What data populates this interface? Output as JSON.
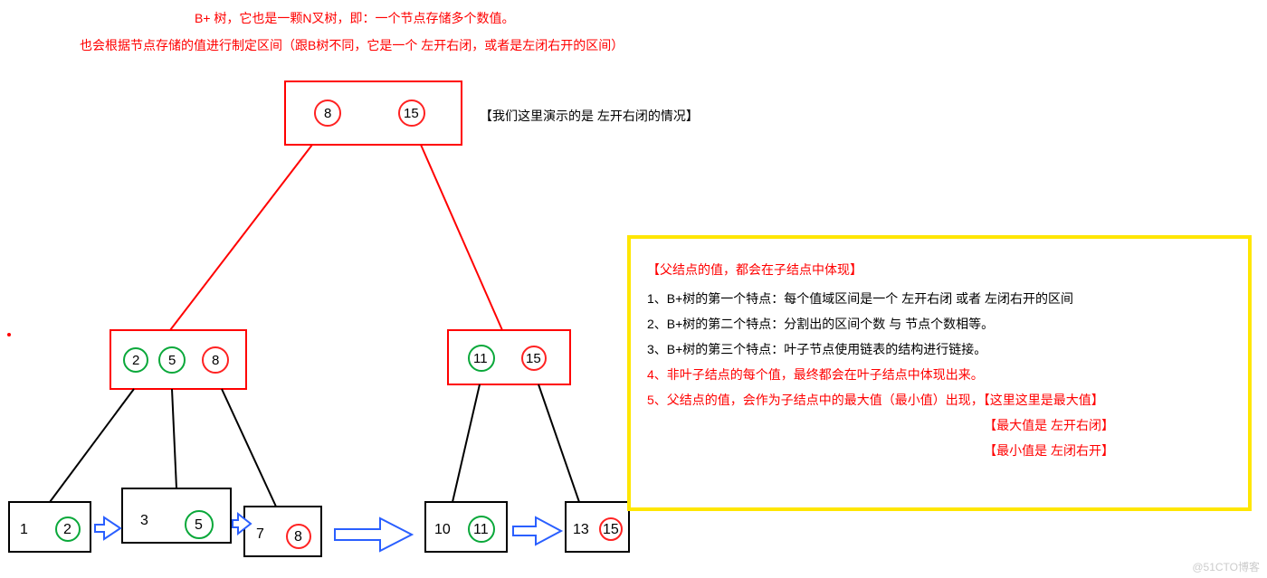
{
  "header": {
    "line1": "B+ 树，它也是一颗N叉树，即：一个节点存储多个数值。",
    "line2": "也会根据节点存储的值进行制定区间（跟B树不同，它是一个 左开右闭，或者是左闭右开的区间）"
  },
  "root": {
    "values": [
      "8",
      "15"
    ],
    "note": "【我们这里演示的是 左开右闭的情况】"
  },
  "mid_left": {
    "values": [
      "2",
      "5",
      "8"
    ]
  },
  "mid_right": {
    "values": [
      "11",
      "15"
    ]
  },
  "leaves": [
    {
      "values": [
        "1",
        "2"
      ]
    },
    {
      "values": [
        "3",
        "5"
      ]
    },
    {
      "values": [
        "7",
        "8"
      ]
    },
    {
      "values": [
        "10",
        "11"
      ]
    },
    {
      "values": [
        "13",
        "15"
      ]
    }
  ],
  "infobox": {
    "title": "【父结点的值，都会在子结点中体现】",
    "items": [
      "1、B+树的第一个特点：每个值域区间是一个 左开右闭 或者 左闭右开的区间",
      "2、B+树的第二个特点：分割出的区间个数 与 节点个数相等。",
      "3、B+树的第三个特点：叶子节点使用链表的结构进行链接。",
      "4、非叶子结点的每个值，最终都会在叶子结点中体现出来。",
      "5、父结点的值，会作为子结点中的最大值（最小值）出现，【这里这里是最大值】"
    ],
    "foot1": "【最大值是 左开右闭】",
    "foot2": "【最小值是 左闭右开】"
  },
  "watermark": "@51CTO博客"
}
